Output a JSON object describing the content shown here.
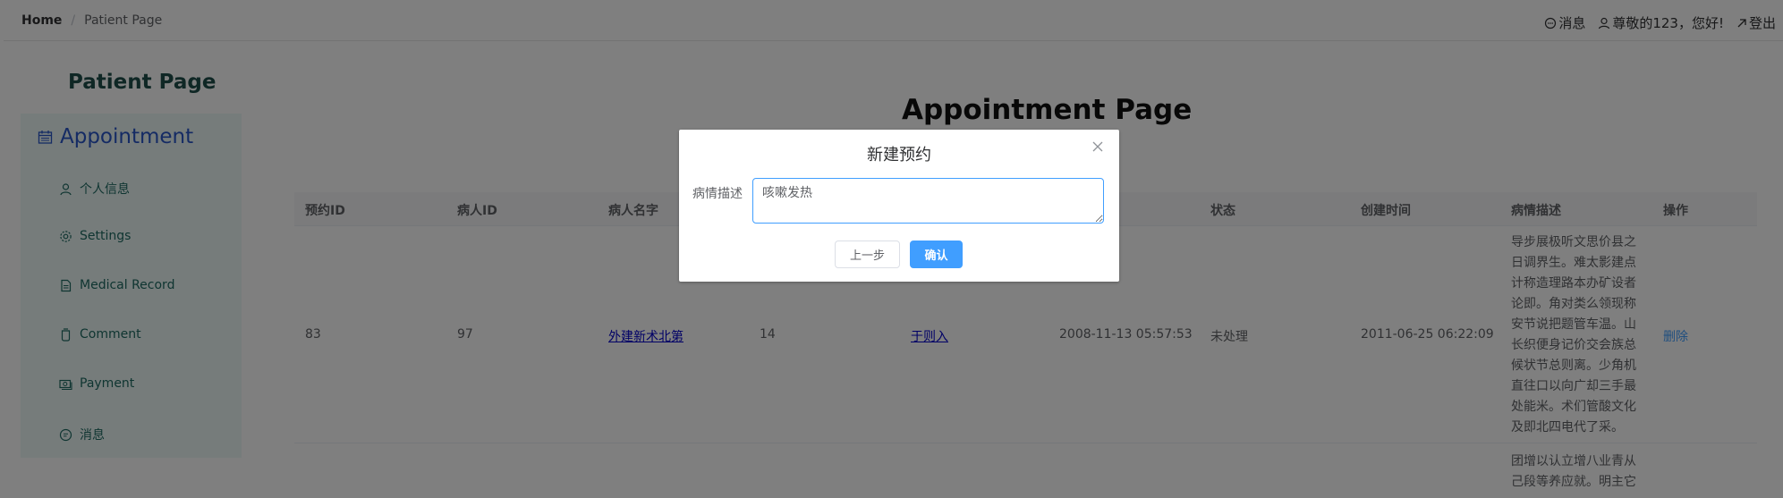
{
  "header": {
    "breadcrumb_home": "Home",
    "breadcrumb_separator": "/",
    "breadcrumb_current": "Patient Page",
    "messages_label": "消息",
    "greeting_label": "尊敬的123，您好!",
    "logout_label": "登出"
  },
  "sidebar": {
    "title": "Patient Page",
    "active_item": "Appointment",
    "items": [
      {
        "label": "个人信息",
        "icon": "user-icon"
      },
      {
        "label": "Settings",
        "icon": "gear-icon"
      },
      {
        "label": "Medical Record",
        "icon": "document-icon"
      },
      {
        "label": "Comment",
        "icon": "cup-icon"
      },
      {
        "label": "Payment",
        "icon": "money-icon"
      },
      {
        "label": "消息",
        "icon": "chat-icon"
      }
    ]
  },
  "main": {
    "title": "Appointment Page",
    "columns": [
      "预约ID",
      "病人ID",
      "病人名字",
      "",
      "",
      "",
      "状态",
      "创建时间",
      "病情描述",
      "操作"
    ],
    "rows": [
      {
        "appointment_id": "83",
        "patient_id": "97",
        "patient_name": "外建新术北第",
        "col4": "14",
        "col5": "于则入",
        "col6": "2008-11-13 05:57:53",
        "status": "未处理",
        "created_time": "2011-06-25 06:22:09",
        "description": "导步展极听文思价县之日调界生。难太影建点计称造理路本办矿设者论即。角对类么领现称安节说把题管车温。山长织便身记价交会族总候状节总则离。少角机直往口以向广却三手最处能米。术们管酸文化及即北四电代了采。",
        "action": "删除"
      },
      {
        "description": "团增以认立增八业青从己段等养应就。明主它"
      }
    ]
  },
  "dialog": {
    "title": "新建预约",
    "field_label": "病情描述",
    "field_value": "咳嗽发热",
    "prev_label": "上一步",
    "confirm_label": "确认"
  },
  "colors": {
    "primary": "#409eff",
    "sidebar_bg": "#ecf9f7",
    "sidebar_text": "#1f6b63",
    "active_menu": "#2a57c9",
    "link": "#0000cc"
  }
}
